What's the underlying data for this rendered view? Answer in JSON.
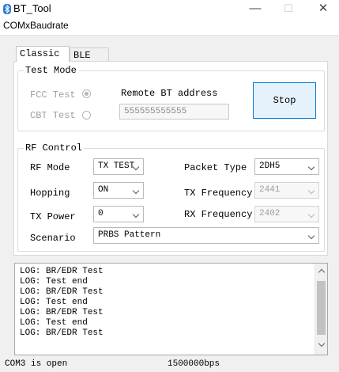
{
  "window": {
    "title": "BT_Tool",
    "minimize_glyph": "—",
    "maximize_glyph": "☐",
    "close_glyph": "✕"
  },
  "menu": {
    "items": [
      "COMx",
      "Baudrate"
    ]
  },
  "tabs": [
    {
      "label": "Classic",
      "active": true
    },
    {
      "label": "BLE",
      "active": false
    }
  ],
  "test_mode": {
    "legend": "Test Mode",
    "fcc_label": "FCC Test",
    "fcc_checked": true,
    "cbt_label": "CBT Test",
    "cbt_checked": false,
    "remote_label": "Remote BT address",
    "remote_value": "555555555555",
    "stop_label": "Stop"
  },
  "rf_control": {
    "legend": "RF Control",
    "rf_mode_label": "RF Mode",
    "rf_mode_value": "TX TEST",
    "packet_type_label": "Packet Type",
    "packet_type_value": "2DH5",
    "hopping_label": "Hopping",
    "hopping_value": "ON",
    "tx_freq_label": "TX Frequency",
    "tx_freq_value": "2441",
    "tx_power_label": "TX Power",
    "tx_power_value": "0",
    "rx_freq_label": "RX Frequency",
    "rx_freq_value": "2402",
    "scenario_label": "Scenario",
    "scenario_value": "PRBS Pattern"
  },
  "log": {
    "lines": [
      "LOG: BR/EDR Test",
      "LOG: Test end",
      "LOG: BR/EDR Test",
      "LOG: Test end",
      "LOG: BR/EDR Test",
      "LOG: Test end",
      "LOG: BR/EDR Test"
    ]
  },
  "status": {
    "port": "COM3 is open",
    "baud": "1500000bps"
  },
  "colors": {
    "accent": "#0078d7",
    "button_bg": "#e5f1fb",
    "bluetooth_icon": "#2f7fd6"
  },
  "icons": {
    "app": "bluetooth-icon"
  }
}
